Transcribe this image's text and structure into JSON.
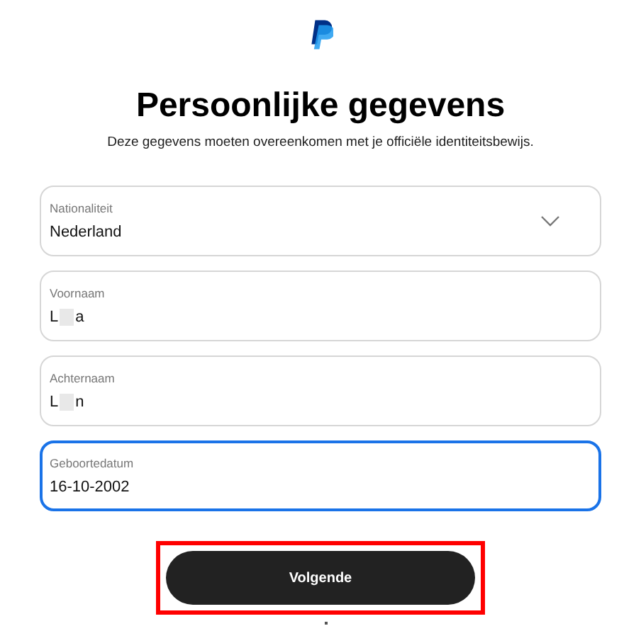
{
  "title": "Persoonlijke gegevens",
  "subtitle": "Deze gegevens moeten overeenkomen met je officiële identiteitsbewijs.",
  "fields": [
    {
      "kind": "select",
      "label": "Nationaliteit",
      "value": "Nederland",
      "focused": false
    },
    {
      "kind": "text",
      "label": "Voornaam",
      "value": "L",
      "value_end": "a",
      "redacted": true,
      "focused": false
    },
    {
      "kind": "text",
      "label": "Achternaam",
      "value": "L",
      "value_end": "n",
      "redacted": true,
      "focused": false
    },
    {
      "kind": "text",
      "label": "Geboortedatum",
      "value": "16-10-2002",
      "focused": true
    }
  ],
  "button": {
    "label": "Volgende",
    "highlighted": true
  }
}
